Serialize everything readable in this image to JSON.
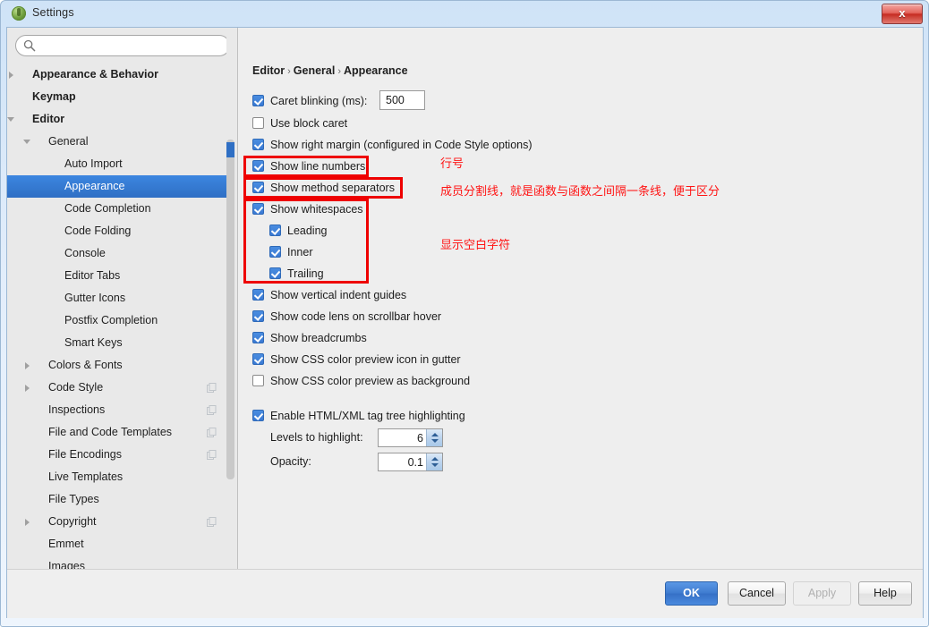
{
  "window": {
    "title": "Settings",
    "app_icon": "idea-app-icon",
    "close_label": "x"
  },
  "sidebar": {
    "search": {
      "value": "",
      "placeholder": "",
      "icon": "search-icon"
    },
    "items": [
      {
        "label": "Appearance & Behavior",
        "indent": 0,
        "twisty": "right",
        "bold": true,
        "selected": false,
        "copy": false
      },
      {
        "label": "Keymap",
        "indent": 0,
        "twisty": "none",
        "bold": true,
        "selected": false,
        "copy": false
      },
      {
        "label": "Editor",
        "indent": 0,
        "twisty": "down",
        "bold": true,
        "selected": false,
        "copy": false
      },
      {
        "label": "General",
        "indent": 1,
        "twisty": "down",
        "bold": false,
        "selected": false,
        "copy": false
      },
      {
        "label": "Auto Import",
        "indent": 2,
        "twisty": "none",
        "bold": false,
        "selected": false,
        "copy": false
      },
      {
        "label": "Appearance",
        "indent": 2,
        "twisty": "none",
        "bold": false,
        "selected": true,
        "copy": false
      },
      {
        "label": "Code Completion",
        "indent": 2,
        "twisty": "none",
        "bold": false,
        "selected": false,
        "copy": false
      },
      {
        "label": "Code Folding",
        "indent": 2,
        "twisty": "none",
        "bold": false,
        "selected": false,
        "copy": false
      },
      {
        "label": "Console",
        "indent": 2,
        "twisty": "none",
        "bold": false,
        "selected": false,
        "copy": false
      },
      {
        "label": "Editor Tabs",
        "indent": 2,
        "twisty": "none",
        "bold": false,
        "selected": false,
        "copy": false
      },
      {
        "label": "Gutter Icons",
        "indent": 2,
        "twisty": "none",
        "bold": false,
        "selected": false,
        "copy": false
      },
      {
        "label": "Postfix Completion",
        "indent": 2,
        "twisty": "none",
        "bold": false,
        "selected": false,
        "copy": false
      },
      {
        "label": "Smart Keys",
        "indent": 2,
        "twisty": "none",
        "bold": false,
        "selected": false,
        "copy": false
      },
      {
        "label": "Colors & Fonts",
        "indent": 1,
        "twisty": "right",
        "bold": false,
        "selected": false,
        "copy": false
      },
      {
        "label": "Code Style",
        "indent": 1,
        "twisty": "right",
        "bold": false,
        "selected": false,
        "copy": true
      },
      {
        "label": "Inspections",
        "indent": 1,
        "twisty": "none",
        "bold": false,
        "selected": false,
        "copy": true
      },
      {
        "label": "File and Code Templates",
        "indent": 1,
        "twisty": "none",
        "bold": false,
        "selected": false,
        "copy": true
      },
      {
        "label": "File Encodings",
        "indent": 1,
        "twisty": "none",
        "bold": false,
        "selected": false,
        "copy": true
      },
      {
        "label": "Live Templates",
        "indent": 1,
        "twisty": "none",
        "bold": false,
        "selected": false,
        "copy": false
      },
      {
        "label": "File Types",
        "indent": 1,
        "twisty": "none",
        "bold": false,
        "selected": false,
        "copy": false
      },
      {
        "label": "Copyright",
        "indent": 1,
        "twisty": "right",
        "bold": false,
        "selected": false,
        "copy": true
      },
      {
        "label": "Emmet",
        "indent": 1,
        "twisty": "none",
        "bold": false,
        "selected": false,
        "copy": false
      },
      {
        "label": "Images",
        "indent": 1,
        "twisty": "none",
        "bold": false,
        "selected": false,
        "copy": false
      }
    ]
  },
  "main": {
    "breadcrumb": {
      "root": "Editor",
      "mid": "General",
      "leaf": "Appearance",
      "separator": "›"
    },
    "options": [
      {
        "label": "Caret blinking (ms):",
        "checked": true
      },
      {
        "label": "Use block caret",
        "checked": false
      },
      {
        "label": "Show right margin (configured in Code Style options)",
        "checked": true
      },
      {
        "label": "Show line numbers",
        "checked": true
      },
      {
        "label": "Show method separators",
        "checked": true
      },
      {
        "label": "Show whitespaces",
        "checked": true
      },
      {
        "label": "Leading",
        "checked": true
      },
      {
        "label": "Inner",
        "checked": true
      },
      {
        "label": "Trailing",
        "checked": true
      },
      {
        "label": "Show vertical indent guides",
        "checked": true
      },
      {
        "label": "Show code lens on scrollbar hover",
        "checked": true
      },
      {
        "label": "Show breadcrumbs",
        "checked": true
      },
      {
        "label": "Show CSS color preview icon in gutter",
        "checked": true
      },
      {
        "label": "Show CSS color preview as background",
        "checked": false
      },
      {
        "label": "Enable HTML/XML tag tree highlighting",
        "checked": true
      }
    ],
    "caret_blinking_value": "500",
    "levels_label": "Levels to highlight:",
    "levels_value": "6",
    "opacity_label": "Opacity:",
    "opacity_value": "0.1"
  },
  "annotations": {
    "color": "#ff1414",
    "box_color": "#ee0000",
    "notes": [
      "行号",
      "成员分割线，就是函数与函数之间隔一条线，便于区分",
      "显示空白字符"
    ]
  },
  "footer": {
    "ok": "OK",
    "cancel": "Cancel",
    "apply": "Apply",
    "help": "Help",
    "apply_disabled": true
  }
}
